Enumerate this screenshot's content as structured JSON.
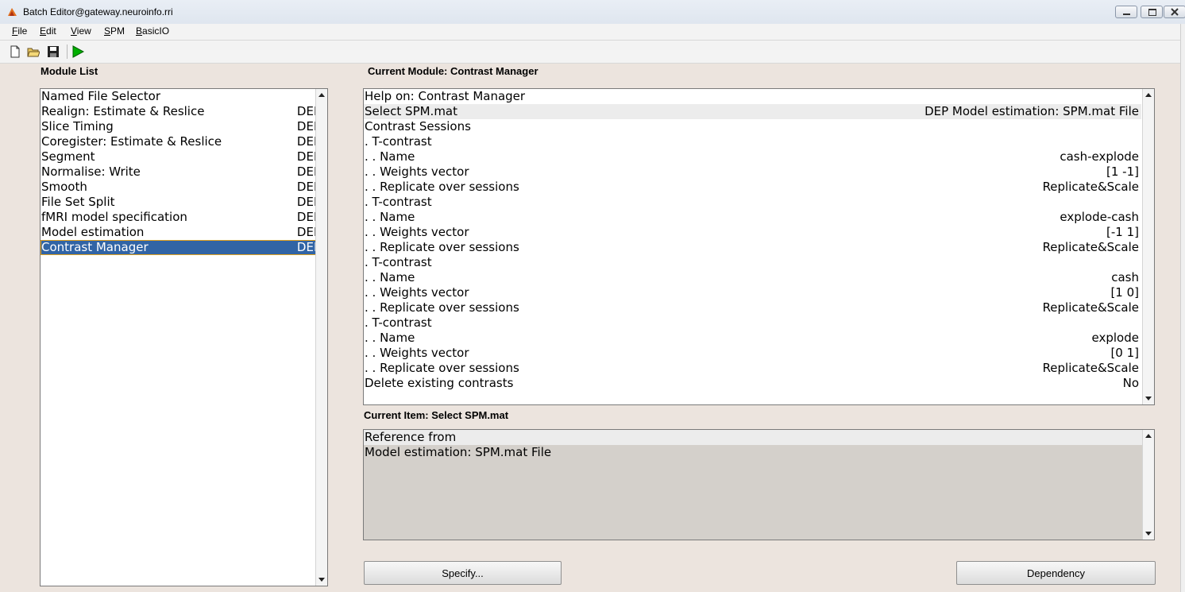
{
  "window": {
    "title": "Batch Editor@gateway.neuroinfo.rri"
  },
  "menu": [
    "File",
    "Edit",
    "View",
    "SPM",
    "BasicIO"
  ],
  "toolbar": {
    "icons": [
      "new-file-icon",
      "open-folder-icon",
      "save-icon",
      "run-icon"
    ],
    "run_color": "#00b000"
  },
  "module_list": {
    "label": "Module List",
    "items": [
      {
        "name": "Named File Selector",
        "dep": ""
      },
      {
        "name": "Realign: Estimate & Reslice",
        "dep": "DEP"
      },
      {
        "name": "Slice Timing",
        "dep": "DEP"
      },
      {
        "name": "Coregister: Estimate & Reslice",
        "dep": "DEP"
      },
      {
        "name": "Segment",
        "dep": "DEP"
      },
      {
        "name": "Normalise: Write",
        "dep": "DEP"
      },
      {
        "name": "Smooth",
        "dep": "DEP"
      },
      {
        "name": "File Set Split",
        "dep": "DEP"
      },
      {
        "name": "fMRI model specification",
        "dep": "DEP"
      },
      {
        "name": "Model estimation",
        "dep": "DEP"
      },
      {
        "name": "Contrast Manager",
        "dep": "DEP"
      }
    ],
    "selected_index": 10,
    "selection_color": "#3164a5"
  },
  "current_module": {
    "label": "Current Module: Contrast Manager",
    "items": [
      {
        "name": "Help on: Contrast Manager",
        "value": ""
      },
      {
        "name": "Select SPM.mat",
        "value": "DEP Model estimation: SPM.mat File"
      },
      {
        "name": "Contrast Sessions",
        "value": ""
      },
      {
        "name": ". T-contrast",
        "value": ""
      },
      {
        "name": ". . Name",
        "value": "cash-explode"
      },
      {
        "name": ". . Weights vector",
        "value": "[1 -1]"
      },
      {
        "name": ". . Replicate over sessions",
        "value": "Replicate&Scale"
      },
      {
        "name": ". T-contrast",
        "value": ""
      },
      {
        "name": ". . Name",
        "value": "explode-cash"
      },
      {
        "name": ". . Weights vector",
        "value": "[-1 1]"
      },
      {
        "name": ". . Replicate over sessions",
        "value": "Replicate&Scale"
      },
      {
        "name": ". T-contrast",
        "value": ""
      },
      {
        "name": ". . Name",
        "value": "cash"
      },
      {
        "name": ". . Weights vector",
        "value": "[1 0]"
      },
      {
        "name": ". . Replicate over sessions",
        "value": "Replicate&Scale"
      },
      {
        "name": ". T-contrast",
        "value": ""
      },
      {
        "name": ". . Name",
        "value": "explode"
      },
      {
        "name": ". . Weights vector",
        "value": "[0 1]"
      },
      {
        "name": ". . Replicate over sessions",
        "value": "Replicate&Scale"
      },
      {
        "name": "Delete existing contrasts",
        "value": "No"
      }
    ],
    "highlighted_index": 1
  },
  "current_item": {
    "label": "Current Item: Select SPM.mat",
    "lines": [
      "Reference from",
      "Model estimation: SPM.mat File"
    ]
  },
  "buttons": {
    "specify": "Specify...",
    "dependency": "Dependency"
  }
}
